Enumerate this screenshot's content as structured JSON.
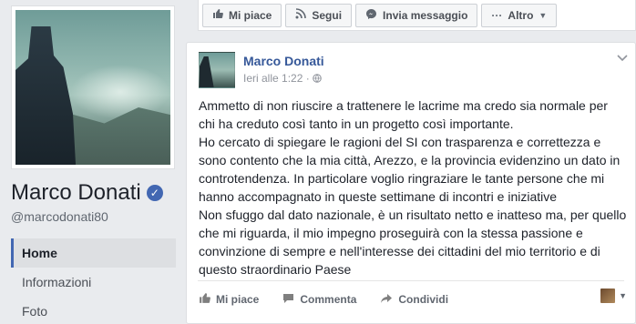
{
  "profile": {
    "name": "Marco Donati",
    "username": "@marcodonati80",
    "verified_icon": "verified-check-icon"
  },
  "side_nav": [
    {
      "label": "Home",
      "active": true
    },
    {
      "label": "Informazioni",
      "active": false
    },
    {
      "label": "Foto",
      "active": false
    }
  ],
  "action_bar": {
    "like": {
      "label": "Mi piace",
      "icon": "thumbs-up-icon"
    },
    "follow": {
      "label": "Segui",
      "icon": "rss-icon"
    },
    "message": {
      "label": "Invia messaggio",
      "icon": "messenger-icon"
    },
    "more": {
      "label": "Altro",
      "icon": "ellipsis-icon"
    }
  },
  "post": {
    "author": "Marco Donati",
    "time": "Ieri alle 1:22",
    "privacy_icon": "globe-icon",
    "paragraphs": [
      "Ammetto di non riuscire a trattenere le lacrime ma credo sia normale per chi ha creduto così tanto in un progetto così importante.",
      "Ho cercato di spiegare le ragioni del SI con trasparenza e correttezza e sono contento che la mia città, Arezzo, e la provincia evidenzino un dato in controtendenza. In particolare voglio ringraziare le tante persone che mi hanno accompagnato in queste settimane di incontri e iniziative",
      "Non sfuggo dal dato nazionale, è un risultato netto e inatteso ma, per quello che mi riguarda, il mio impegno proseguirà con la stessa passione e convinzione di sempre e nell'interesse dei cittadini del mio territorio e di questo straordinario Paese"
    ],
    "actions": {
      "like": "Mi piace",
      "comment": "Commenta",
      "share": "Condividi"
    }
  },
  "colors": {
    "link_blue": "#365899",
    "brand_blue": "#4267b2",
    "background": "#e9ebee"
  }
}
